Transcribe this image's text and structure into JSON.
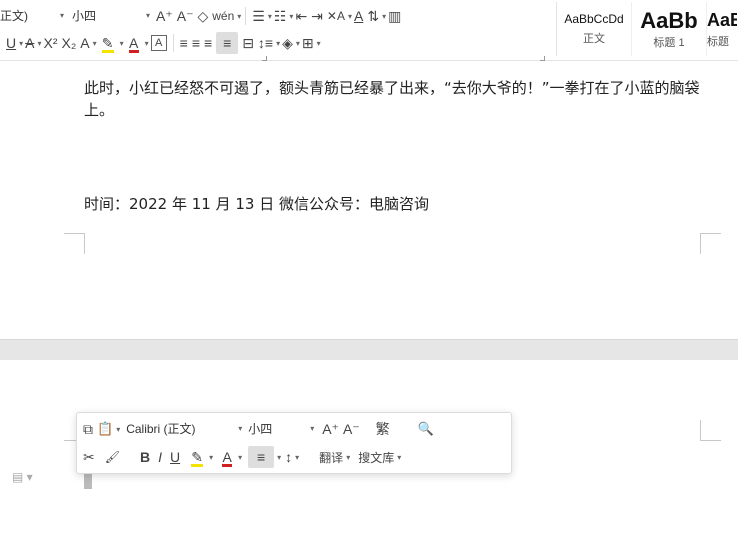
{
  "toolbar": {
    "style_select": "正文)",
    "size_select": "小四",
    "row1_icons": [
      "grow-font-icon",
      "shrink-font-icon",
      "clear-format-icon",
      "phonetic-icon",
      "bullet-list-icon",
      "numbered-list-icon",
      "decrease-indent-icon",
      "increase-indent-icon",
      "text-direction-icon",
      "char-shading-icon",
      "sort-icon",
      "ruler-icon"
    ],
    "row2_icons": [
      "underline-icon",
      "strikethrough-icon",
      "superscript-icon",
      "subscript-icon",
      "text-effect-icon",
      "highlight-icon",
      "font-color-icon",
      "char-border-icon",
      "align-left-icon",
      "align-center-icon",
      "align-right-icon",
      "justify-icon",
      "distributed-icon",
      "line-spacing-icon",
      "shading-icon",
      "borders-icon"
    ],
    "row1_glyphs": {
      "grow": "A⁺",
      "shrink": "A⁻",
      "clear": "◇",
      "phonetic": "wén",
      "bullets": "☰",
      "numbers": "☷",
      "dec": "⇤",
      "inc": "⇥",
      "textdir": "✕A",
      "shade": "A",
      "sort": "⇅",
      "ruler": "▥"
    },
    "row2_glyphs": {
      "underline": "U",
      "strike": "A",
      "sup": "X²",
      "sub": "X₂",
      "effect": "A",
      "highlight": "✎",
      "fontcolor": "A",
      "border": "A",
      "left": "≡",
      "center": "≡",
      "right": "≡",
      "justify": "≡",
      "dist": "⊟",
      "spacing": "↕≡",
      "shading": "◈",
      "borders": "⊞"
    },
    "highlight_color": "#f5e400",
    "font_color": "#d22020"
  },
  "styles": [
    {
      "preview": "AaBbCcDd",
      "name": "正文"
    },
    {
      "preview": "AaBb",
      "name": "标题 1"
    },
    {
      "preview": "AaB",
      "name": "标题"
    }
  ],
  "document": {
    "paragraph": "此时，小红已经怒不可遏了，额头青筋已经暴了出来，“去你大爷的！”一拳打在了小蓝的脑袋上。",
    "dateline": "时间：2022 年 11 月 13 日  微信公众号：电脑咨询"
  },
  "mini_toolbar": {
    "font": "Calibri (正文)",
    "size": "小四",
    "translate": "翻译",
    "search_lib": "搜文库",
    "glyphs": {
      "copy": "⧉",
      "paste": "📋",
      "grow": "A⁺",
      "shrink": "A⁻",
      "convert": "繁",
      "search": "🔍",
      "cut": "✂",
      "brush": "🖌",
      "bold": "B",
      "italic": "I",
      "underline": "U",
      "highlight": "✎",
      "fontcolor": "A",
      "align": "≡",
      "spacing": "↕"
    }
  }
}
